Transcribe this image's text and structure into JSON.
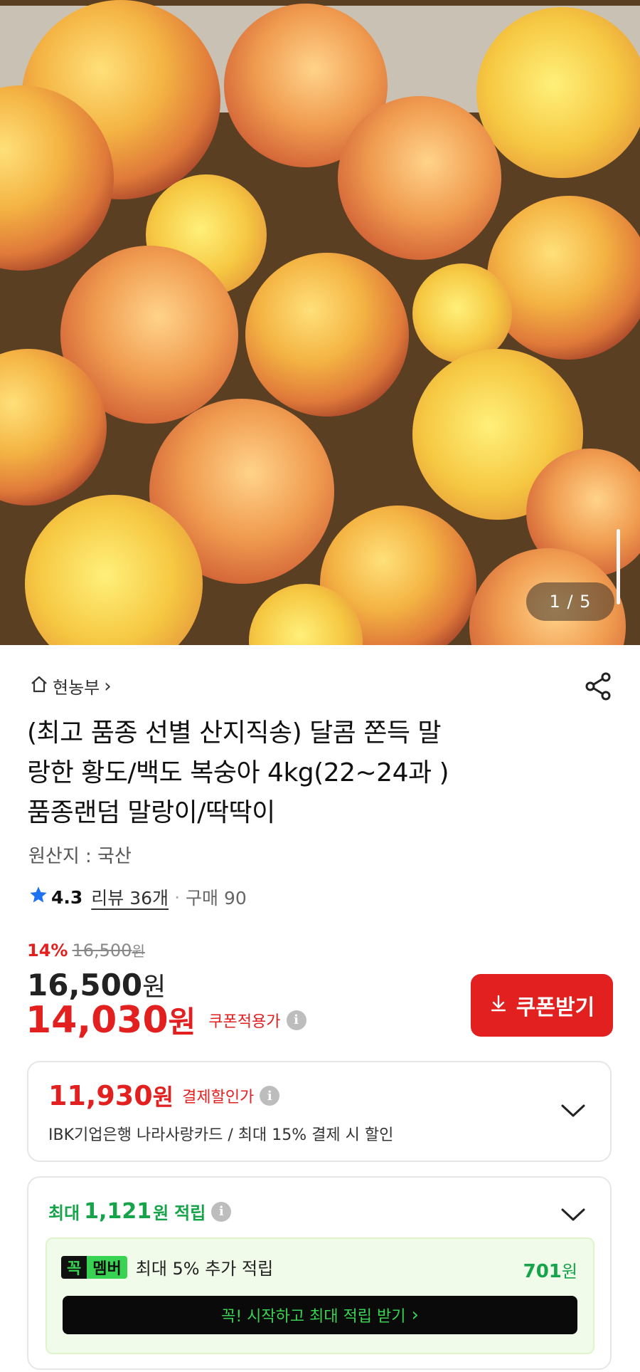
{
  "product_image": {
    "pager_current": "1",
    "pager_total": "5",
    "pager_text": "1 / 5"
  },
  "store": {
    "name": "현농부",
    "chevron": "›"
  },
  "product": {
    "title_lines": [
      "(최고 품종 선별 산지직송) 달콤 쫀득 말",
      "랑한 황도/백도 복숭아 4kg(22~24과 )",
      "품종랜덤 말랑이/딱딱이"
    ],
    "origin": "원산지 : 국산",
    "rating": "4.3",
    "reviews": "리뷰 36개",
    "purchases": "구매 90"
  },
  "price": {
    "discount_pct": "14%",
    "original": "16,500",
    "original_won": "원",
    "current": "16,500",
    "current_won": "원",
    "coupon_price": "14,030",
    "coupon_won": "원",
    "coupon_label": "쿠폰적용가",
    "coupon_button": "쿠폰받기"
  },
  "payment_discount": {
    "amount": "11,930",
    "won": "원",
    "label": "결제할인가",
    "description": "IBK기업은행 나라사랑카드 / 최대 15% 결제 시 할인"
  },
  "rewards": {
    "prefix": "최대",
    "amount": "1,121",
    "won": "원",
    "suffix": "적립",
    "member_badge_1": "꼭",
    "member_badge_2": "멤버",
    "member_text": "최대 5% 추가 적립",
    "member_points": "701",
    "member_points_won": "원",
    "start_button": "꼭! 시작하고 최대 적립 받기",
    "start_button_arrow": "›"
  },
  "colors": {
    "brand_red": "#e2201f",
    "reward_green": "#16a34a",
    "member_green": "#39d353",
    "star_blue": "#1d72f2"
  },
  "icons": [
    "home-icon",
    "share-icon",
    "star-icon",
    "info-icon",
    "download-icon",
    "chevron-down-icon"
  ]
}
